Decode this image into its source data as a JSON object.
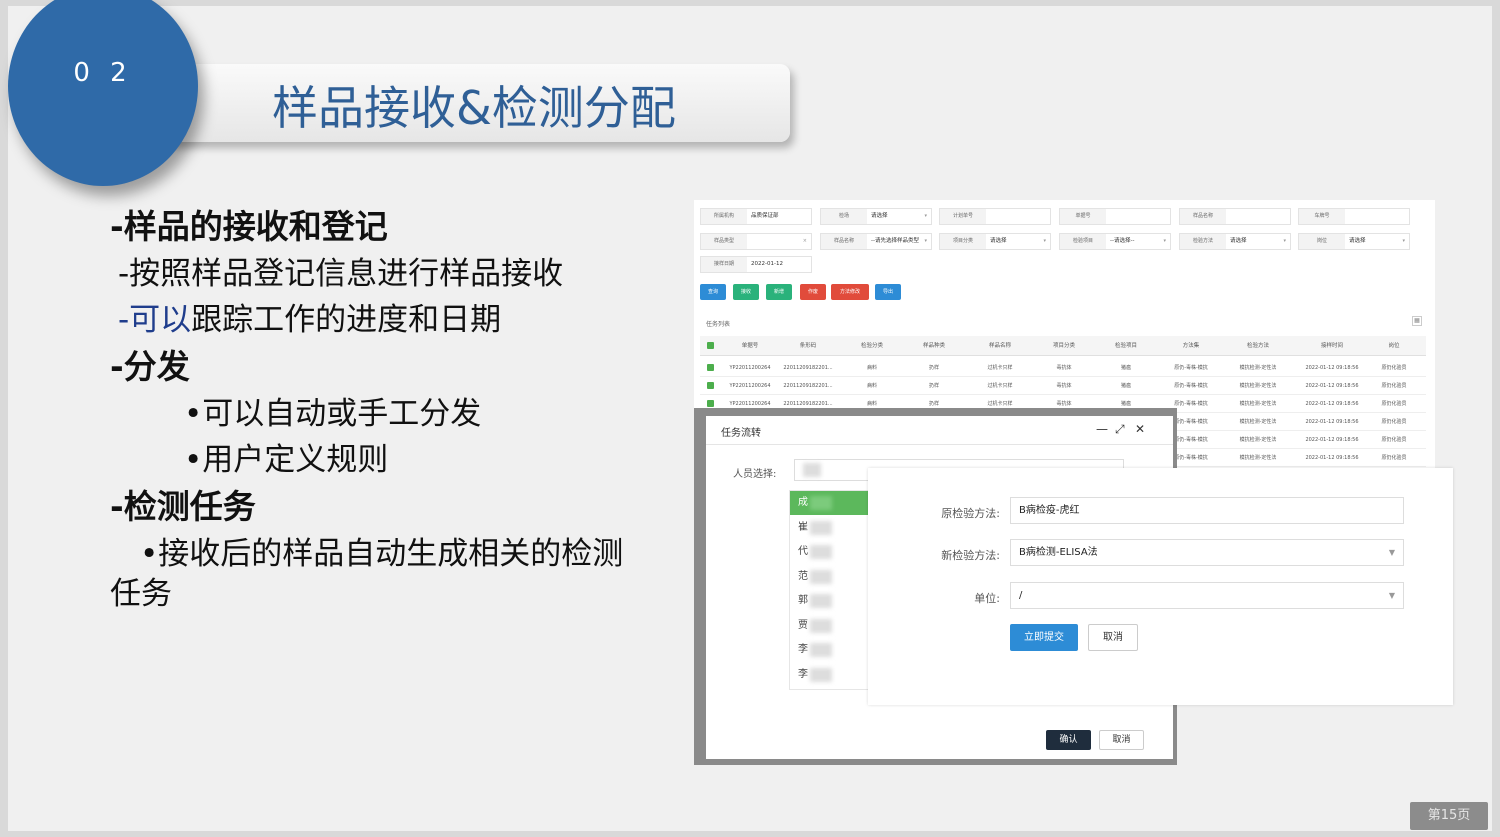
{
  "slide": {
    "number": "0 2",
    "title": "样品接收&检测分配",
    "page_label": "第15页"
  },
  "bullets": {
    "h1": "-样品的接收和登记",
    "h1_a": "-按照样品登记信息进行样品接收",
    "h1_b_prefix": "-可以",
    "h1_b_rest": "跟踪工作的进度和日期",
    "h2": "-分发",
    "h2_a": "•可以自动或手工分发",
    "h2_b": "•用户定义规则",
    "h3": "-检测任务",
    "h3_a1": "•接收后的样品自动生成相关的检测",
    "h3_a2": "任务"
  },
  "form": {
    "fields": [
      {
        "label": "所属机构",
        "value": "品质保证部",
        "caret": ""
      },
      {
        "label": "检场",
        "value": "请选择",
        "caret": "▾"
      },
      {
        "label": "计划单号",
        "value": "",
        "caret": ""
      },
      {
        "label": "单据号",
        "value": "",
        "caret": ""
      },
      {
        "label": "样品名称",
        "value": "",
        "caret": ""
      },
      {
        "label": "车牌号",
        "value": "",
        "caret": ""
      },
      {
        "label": "样品类型",
        "value": "",
        "caret": "×"
      },
      {
        "label": "样品名称",
        "value": "--请先选择样品类型",
        "caret": "▾"
      },
      {
        "label": "项目分类",
        "value": "请选择",
        "caret": "▾"
      },
      {
        "label": "检验项目",
        "value": "--请选择--",
        "caret": "▾"
      },
      {
        "label": "检验方法",
        "value": "请选择",
        "caret": "▾"
      },
      {
        "label": "岗位",
        "value": "请选择",
        "caret": "▾"
      },
      {
        "label": "接样日期",
        "value": "2022-01-12",
        "caret": ""
      }
    ],
    "buttons": [
      {
        "label": "查询",
        "color": "#2d8cd6"
      },
      {
        "label": "接收",
        "color": "#2ab27b"
      },
      {
        "label": "新增",
        "color": "#2ab27b"
      },
      {
        "label": "作废",
        "color": "#e14b3b"
      },
      {
        "label": "方法修改",
        "color": "#e14b3b"
      },
      {
        "label": "导出",
        "color": "#2d8cd6"
      }
    ],
    "table_label": "任务列表",
    "table_icon": "grid-icon",
    "columns": [
      "单据号",
      "条形码",
      "检验分类",
      "样品种类",
      "样品名称",
      "项目分类",
      "检验项目",
      "方法集",
      "检验方法",
      "接样时间",
      "岗位"
    ],
    "rows": [
      [
        "YP22011200264",
        "22011209182201...",
        "病料",
        "扔样",
        "过机卡只样",
        "毒抗体",
        "猪瘟",
        "原仍-毒株-模抗",
        "模抗检测-定性法",
        "2022-01-12 09:18:56",
        "原仍化验员"
      ],
      [
        "YP22011200264",
        "22011209182201...",
        "病料",
        "扔样",
        "过机卡只样",
        "毒抗体",
        "猪瘟",
        "原仍-毒株-模抗",
        "模抗检测-定性法",
        "2022-01-12 09:18:56",
        "原仍化验员"
      ],
      [
        "YP22011200264",
        "22011209182201...",
        "病料",
        "扔样",
        "过机卡只样",
        "毒抗体",
        "猪瘟",
        "原仍-毒株-模抗",
        "模抗检测-定性法",
        "2022-01-12 09:18:56",
        "原仍化验员"
      ],
      [
        "",
        "",
        "",
        "",
        "",
        "",
        "",
        "原仍-毒株-模抗",
        "模抗检测-定性法",
        "2022-01-12 09:18:56",
        "原仍化验员"
      ],
      [
        "",
        "",
        "",
        "",
        "",
        "",
        "",
        "原仍-毒株-模抗",
        "模抗检测-定性法",
        "2022-01-12 09:18:56",
        "原仍化验员"
      ],
      [
        "",
        "",
        "",
        "",
        "",
        "",
        "",
        "原仍-毒株-模抗",
        "模抗检测-定性法",
        "2022-01-12 09:18:56",
        "原仍化验员"
      ]
    ]
  },
  "dialog1": {
    "title": "任务流转",
    "minimize": "—",
    "maximize": "⤢",
    "close": "✕",
    "person_label": "人员选择:",
    "persons": [
      "成",
      "崔",
      "代",
      "范",
      "郭",
      "贾",
      "李",
      "李"
    ],
    "confirm": "确认",
    "cancel": "取消"
  },
  "dialog2": {
    "orig_label": "原检验方法:",
    "orig_value": "B病检疫-虎红",
    "new_label": "新检验方法:",
    "new_value": "B病检测-ELISA法",
    "unit_label": "单位:",
    "unit_value": "/",
    "submit": "立即提交",
    "cancel": "取消"
  }
}
